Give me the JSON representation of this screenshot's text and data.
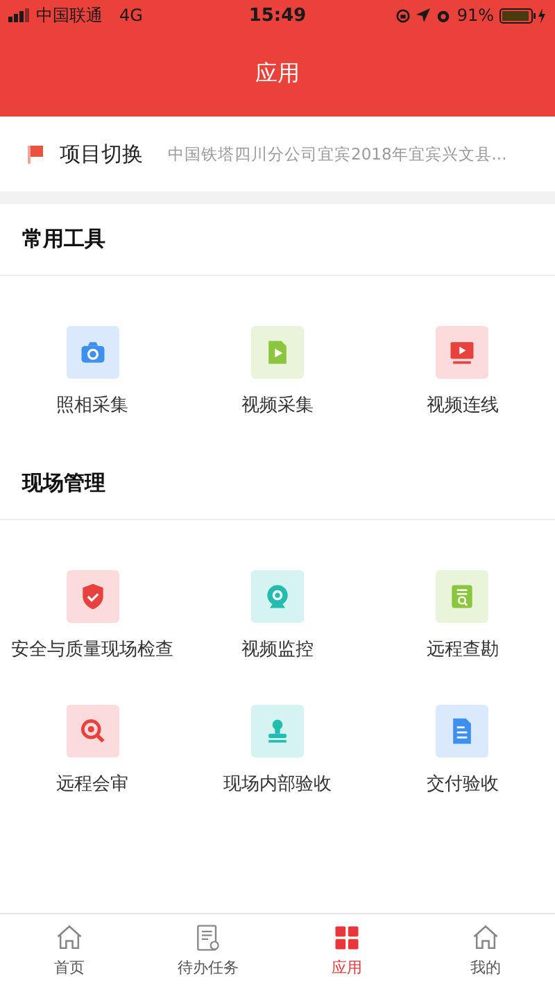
{
  "status_bar": {
    "carrier": "中国联通",
    "network": "4G",
    "time": "15:49",
    "battery": "91%"
  },
  "header": {
    "title": "应用"
  },
  "project": {
    "label": "项目切换",
    "value": "中国铁塔四川分公司宜宾2018年宜宾兴文县..."
  },
  "sections": [
    {
      "title": "常用工具",
      "tools": [
        {
          "label": "照相采集",
          "kind": "camera",
          "color": "#3d8ff0"
        },
        {
          "label": "视频采集",
          "kind": "videofile",
          "color": "#8cc63f"
        },
        {
          "label": "视频连线",
          "kind": "monitor",
          "color": "#e8423e"
        }
      ]
    },
    {
      "title": "现场管理",
      "tools": [
        {
          "label": "安全与质量现场检查",
          "kind": "shield",
          "color": "#e8423e"
        },
        {
          "label": "视频监控",
          "kind": "webcam",
          "color": "#22bdb0"
        },
        {
          "label": "远程查勘",
          "kind": "docsearch",
          "color": "#8cc63f"
        },
        {
          "label": "远程会审",
          "kind": "magnifier",
          "color": "#e8423e"
        },
        {
          "label": "现场内部验收",
          "kind": "stamp",
          "color": "#22bdb0"
        },
        {
          "label": "交付验收",
          "kind": "document",
          "color": "#3d8ff0"
        }
      ]
    }
  ],
  "tabs": [
    {
      "label": "首页",
      "kind": "home",
      "selected": false
    },
    {
      "label": "待办任务",
      "kind": "tasks",
      "selected": false
    },
    {
      "label": "应用",
      "kind": "grid",
      "selected": true
    },
    {
      "label": "我的",
      "kind": "home",
      "selected": false
    }
  ]
}
